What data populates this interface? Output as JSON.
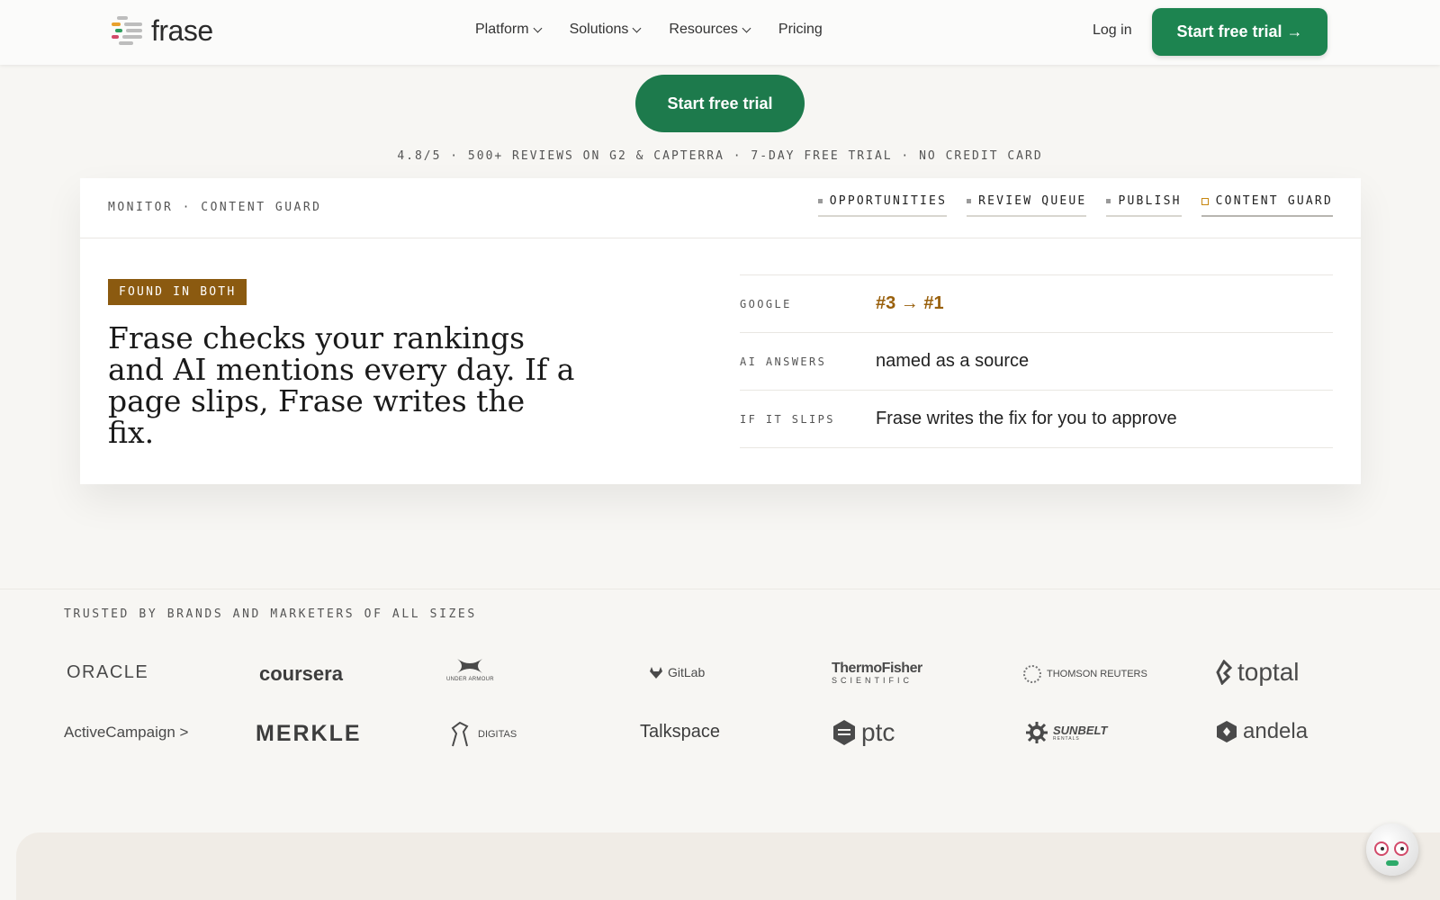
{
  "brand": {
    "name": "frase",
    "accent": "#1d8450",
    "gold": "#8b5a10"
  },
  "nav": {
    "items": [
      {
        "label": "Platform",
        "dropdown": true
      },
      {
        "label": "Solutions",
        "dropdown": true
      },
      {
        "label": "Resources",
        "dropdown": true
      },
      {
        "label": "Pricing",
        "dropdown": false
      }
    ],
    "login": "Log in",
    "cta": "Start free trial →"
  },
  "hero": {
    "cta": "Start free trial",
    "review_line": "4.8/5 · 500+ REVIEWS ON G2 & CAPTERRA · 7-DAY FREE TRIAL · NO CREDIT CARD"
  },
  "card": {
    "crumb": "MONITOR · CONTENT GUARD",
    "tabs": [
      "OPPORTUNITIES",
      "REVIEW QUEUE",
      "PUBLISH",
      "CONTENT GUARD"
    ],
    "active_tab": "CONTENT GUARD",
    "badge": "FOUND IN BOTH",
    "headline": "Frase checks your rankings and AI mentions every day. If a page slips, Frase writes the fix.",
    "rows": [
      {
        "label": "GOOGLE",
        "value": "#3 → #1"
      },
      {
        "label": "AI ANSWERS",
        "value": "named as a source"
      },
      {
        "label": "IF IT SLIPS",
        "value": "Frase writes the fix for you to approve"
      }
    ]
  },
  "trusted": {
    "title": "TRUSTED BY BRANDS AND MARKETERS OF ALL SIZES",
    "logos": [
      "ORACLE",
      "coursera",
      "UNDER ARMOUR",
      "GitLab",
      "ThermoFisher",
      "SCIENTIFIC",
      "THOMSON REUTERS",
      "toptal",
      "ActiveCampaign >",
      "MERKLE",
      "DIGITAS",
      "Talkspace",
      "ptc",
      "SUNBELT",
      "RENTALS",
      "andela"
    ]
  }
}
